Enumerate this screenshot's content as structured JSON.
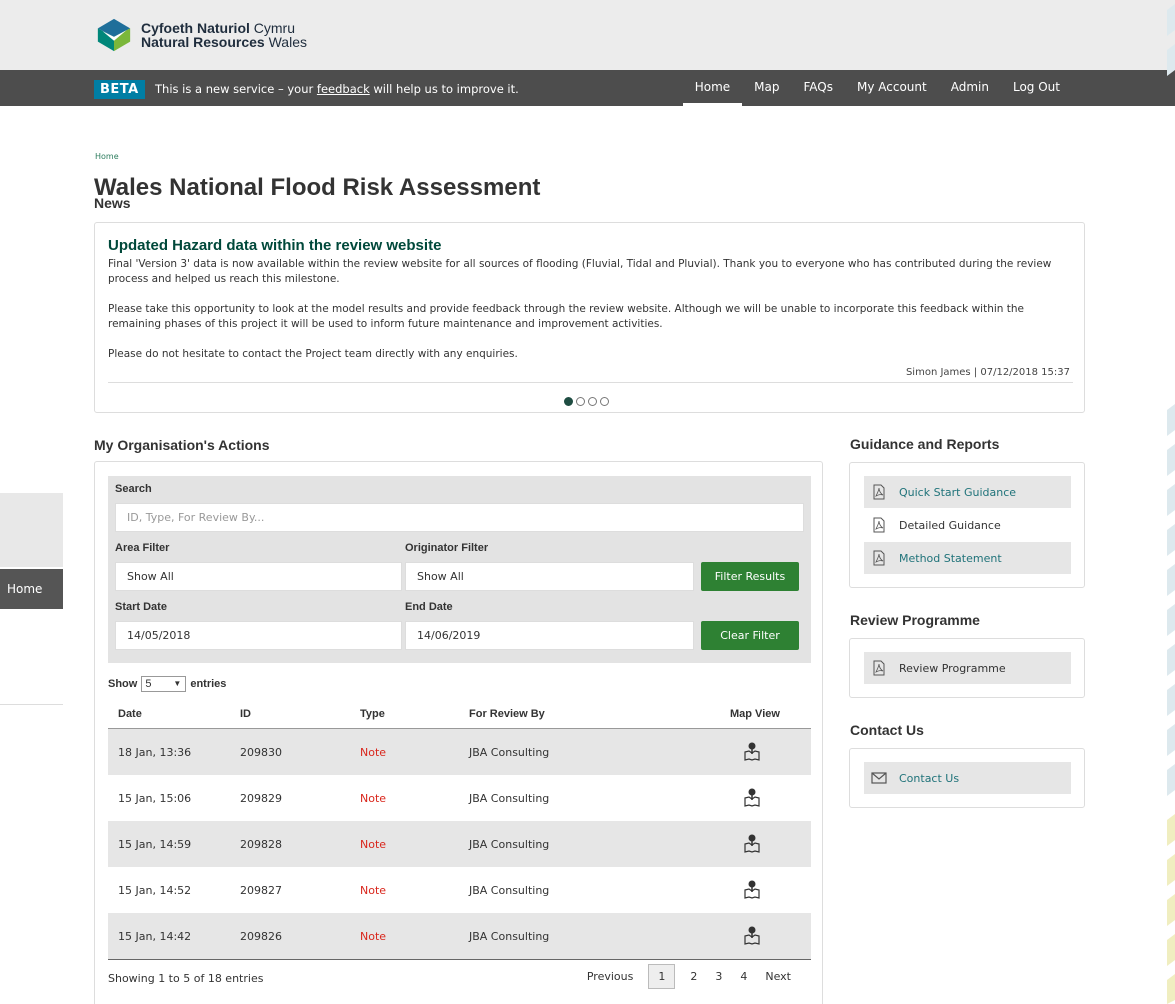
{
  "header": {
    "logo_welsh_bold": "Cyfoeth Naturiol",
    "logo_welsh_light": "Cymru",
    "logo_english_bold": "Natural Resources",
    "logo_english_light": "Wales",
    "beta_badge": "BETA",
    "beta_text_before": "This is a new service – your",
    "beta_link": "feedback",
    "beta_text_after": "will help us to improve it.",
    "nav": [
      {
        "label": "Home",
        "active": true
      },
      {
        "label": "Map"
      },
      {
        "label": "FAQs"
      },
      {
        "label": "My Account"
      },
      {
        "label": "Admin"
      },
      {
        "label": "Log Out"
      }
    ]
  },
  "sidebar": {
    "home_label": "Home"
  },
  "breadcrumb": "Home",
  "page_title": "Wales National Flood Risk Assessment",
  "news": {
    "section_title": "News",
    "headline": "Updated Hazard data within the review website",
    "paragraphs": [
      "Final 'Version 3' data is now available within the review website for all sources of flooding (Fluvial, Tidal and Pluvial). Thank you to everyone who has contributed during the review process and helped us reach this milestone.",
      "Please take this opportunity to look at the model results and provide feedback through the review website. Although we will be unable to incorporate this feedback within the remaining phases of this project it will be used to inform future maintenance and improvement activities.",
      "Please do not hesitate to contact the Project team directly with any enquiries."
    ],
    "meta": "Simon James | 07/12/2018 15:37",
    "slides": 4,
    "active_slide": 1
  },
  "actions": {
    "section_title": "My Organisation's Actions",
    "search_label": "Search",
    "search_placeholder": "ID, Type, For Review By...",
    "area_filter_label": "Area Filter",
    "area_filter_value": "Show All",
    "originator_filter_label": "Originator Filter",
    "originator_filter_value": "Show All",
    "filter_button": "Filter Results",
    "start_date_label": "Start Date",
    "start_date_value": "14/05/2018",
    "end_date_label": "End Date",
    "end_date_value": "14/06/2019",
    "clear_button": "Clear Filter",
    "show_label": "Show",
    "entries_value": "5",
    "entries_label": "entries",
    "columns": [
      "Date",
      "ID",
      "Type",
      "For Review By",
      "Map View"
    ],
    "rows": [
      {
        "date": "18 Jan, 13:36",
        "id": "209830",
        "type": "Note",
        "reviewer": "JBA Consulting"
      },
      {
        "date": "15 Jan, 15:06",
        "id": "209829",
        "type": "Note",
        "reviewer": "JBA Consulting"
      },
      {
        "date": "15 Jan, 14:59",
        "id": "209828",
        "type": "Note",
        "reviewer": "JBA Consulting"
      },
      {
        "date": "15 Jan, 14:52",
        "id": "209827",
        "type": "Note",
        "reviewer": "JBA Consulting"
      },
      {
        "date": "15 Jan, 14:42",
        "id": "209826",
        "type": "Note",
        "reviewer": "JBA Consulting"
      }
    ],
    "summary": "Showing 1 to 5 of 18 entries",
    "pager": {
      "previous": "Previous",
      "pages": [
        "1",
        "2",
        "3",
        "4"
      ],
      "current": "1",
      "next": "Next"
    }
  },
  "guidance": {
    "title": "Guidance and Reports",
    "links": [
      "Quick Start Guidance",
      "Detailed Guidance",
      "Method Statement"
    ]
  },
  "review": {
    "title": "Review Programme",
    "link": "Review Programme"
  },
  "contact": {
    "title": "Contact Us",
    "link": "Contact Us"
  },
  "colors": {
    "navbar": "#4d4d4d",
    "beta": "#007ea4",
    "news_headline": "#00483a",
    "green_button": "#2e8133",
    "note_red": "#d9261c",
    "link_teal": "#20737a"
  }
}
